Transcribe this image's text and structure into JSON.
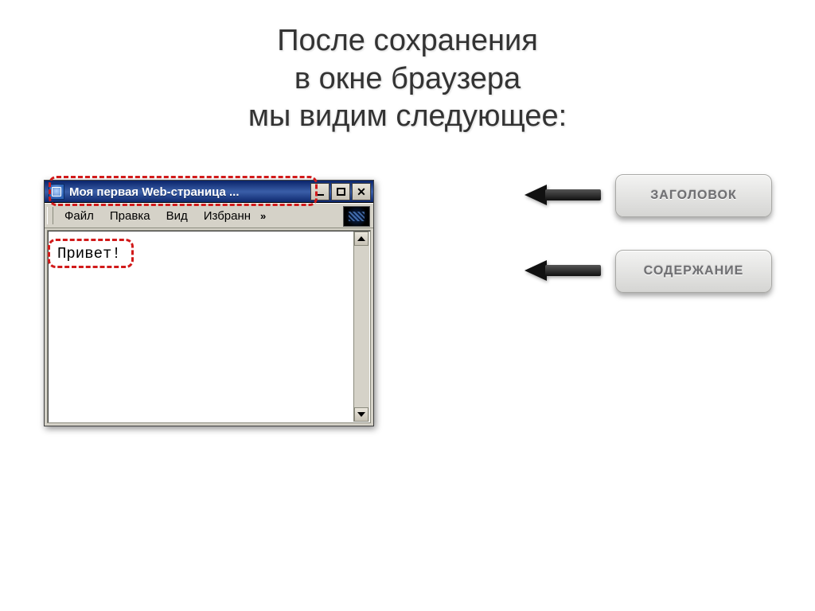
{
  "heading": {
    "line1": "После сохранения",
    "line2": "в окне браузера",
    "line3": "мы видим следующее:"
  },
  "browser": {
    "title": "Моя первая Web-страница ...",
    "menu": {
      "file": "Файл",
      "edit": "Правка",
      "view": "Вид",
      "favorites": "Избранн",
      "overflow": "»"
    },
    "page_text": "Привет!"
  },
  "labels": {
    "title_label": "Заголовок",
    "content_label": "Содержание"
  }
}
